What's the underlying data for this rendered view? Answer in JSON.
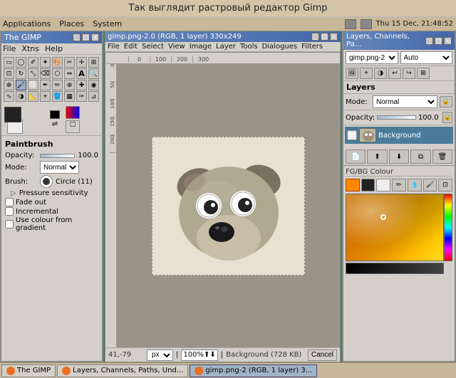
{
  "desktop": {
    "title": "Так выглядит растровый редактор Gimp"
  },
  "systembar": {
    "apps": "Applications",
    "places": "Places",
    "system": "System",
    "datetime": "Thu 15 Dec, 21:48:52"
  },
  "toolbox": {
    "title": "The GIMP",
    "menu": [
      "File",
      "Xtns",
      "Help"
    ],
    "tools": [
      "▭",
      "⊕",
      "⚊",
      "✂",
      "✐",
      "⌖",
      "⊹",
      "∿",
      "🖋",
      "🖌",
      "✏",
      "⌫",
      "🔍",
      "◉",
      "▱",
      "🅐",
      "∬",
      "💧",
      "🎨",
      "🔄"
    ],
    "paintbrush_label": "Paintbrush",
    "opacity_label": "Opacity:",
    "opacity_value": "100.0",
    "mode_label": "Mode:",
    "mode_value": "Normal",
    "brush_label": "Brush:",
    "brush_name": "Circle (11)",
    "pressure_label": "Pressure sensitivity",
    "fade_label": "Fade out",
    "incremental_label": "Incremental",
    "use_colour_label": "Use colour from gradient"
  },
  "canvas": {
    "title": "gimp.png-2.0 (RGB, 1 layer) 330x249",
    "menu": [
      "File",
      "Edit",
      "Select",
      "View",
      "Image",
      "Layer",
      "Tools",
      "Dialogues",
      "Filters"
    ],
    "ruler_ticks": [
      "0",
      "100",
      "200",
      "300"
    ],
    "coord": "41,-79",
    "unit": "px",
    "zoom": "100%",
    "bg_info": "Background (728 KB)",
    "cancel_label": "Cancel"
  },
  "layers": {
    "title": "Layers, Channels, Pa...",
    "image_select": "gimp.png-2",
    "auto_label": "Auto",
    "section": "Layers",
    "mode_label": "Mode:",
    "mode_value": "Normal",
    "opacity_label": "Opacity:",
    "opacity_value": "100.0",
    "layer_name": "Background",
    "fgbg_title": "FG/BG Colour"
  },
  "taskbar": {
    "items": [
      {
        "label": "The GIMP",
        "active": false
      },
      {
        "label": "Layers, Channels, Paths, Und...",
        "active": false
      },
      {
        "label": "gimp.png-2 (RGB, 1 layer) 3...",
        "active": true
      }
    ]
  }
}
